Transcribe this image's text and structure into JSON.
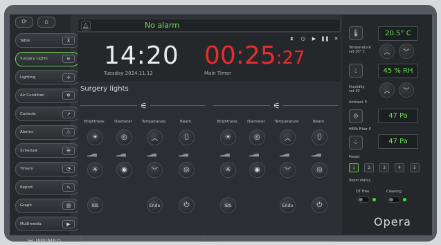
{
  "sidebar": {
    "top_icons": [
      "sync-icon",
      "home-icon"
    ],
    "items": [
      {
        "label": "Table",
        "icon": "⊼",
        "name": "table-icon",
        "active": false
      },
      {
        "label": "Surgery Lights",
        "icon": "⚟",
        "name": "surgery-light-icon",
        "active": true
      },
      {
        "label": "Lighting",
        "icon": "✢",
        "name": "lighting-icon",
        "active": false
      },
      {
        "label": "Air Condition",
        "icon": "❄",
        "name": "snowflake-icon",
        "active": false
      },
      {
        "label": "Controls",
        "icon": "↗",
        "name": "controls-icon",
        "active": false
      },
      {
        "label": "Alarms",
        "icon": "⚠",
        "name": "warning-icon",
        "active": false
      },
      {
        "label": "Schedule",
        "icon": "☰",
        "name": "schedule-icon",
        "active": false
      },
      {
        "label": "Timers",
        "icon": "◔",
        "name": "timer-icon",
        "active": false
      },
      {
        "label": "Report",
        "icon": "∿",
        "name": "report-icon",
        "active": false
      },
      {
        "label": "Graph",
        "icon": "▥",
        "name": "graph-icon",
        "active": false
      },
      {
        "label": "Multimedia",
        "icon": "▶",
        "name": "multimedia-icon",
        "active": false
      }
    ],
    "logo_text": "INFIMED"
  },
  "topbar": {
    "alarm_text": "No alarm"
  },
  "clock": {
    "time": "14:20",
    "date": "Tuesday  2024.11.12",
    "timer_main": "00:25",
    "timer_sec": ":27",
    "timer_label": "Main Timer",
    "controls": [
      "⧗",
      "◷",
      "▶",
      "❚❚",
      "✕"
    ]
  },
  "lights": {
    "title": "Surgery lights",
    "columns": [
      "Brightness",
      "Diameter",
      "Temperature",
      "Beam"
    ],
    "groups": [
      {
        "ibs": "IBS",
        "endo": "Endo"
      },
      {
        "ibs": "IBS",
        "endo": "Endo"
      }
    ]
  },
  "right": {
    "temperature": {
      "value": "20.5° C",
      "label": "Temperature\nset 20° C"
    },
    "humidity": {
      "value": "45 % RH",
      "label": "Humidity\nset 30"
    },
    "ambient": {
      "value": "47 Pa",
      "label": "Ambient P."
    },
    "hepa": {
      "value": "47 Pa",
      "label": "HEPA Filter P."
    },
    "preset_label": "Preset",
    "presets": [
      "1",
      "2",
      "3",
      "4",
      "5"
    ],
    "room_status_label": "Room status",
    "ot_free_label": "OT Free",
    "cleaning_label": "Cleaning",
    "brand": "Opera"
  }
}
